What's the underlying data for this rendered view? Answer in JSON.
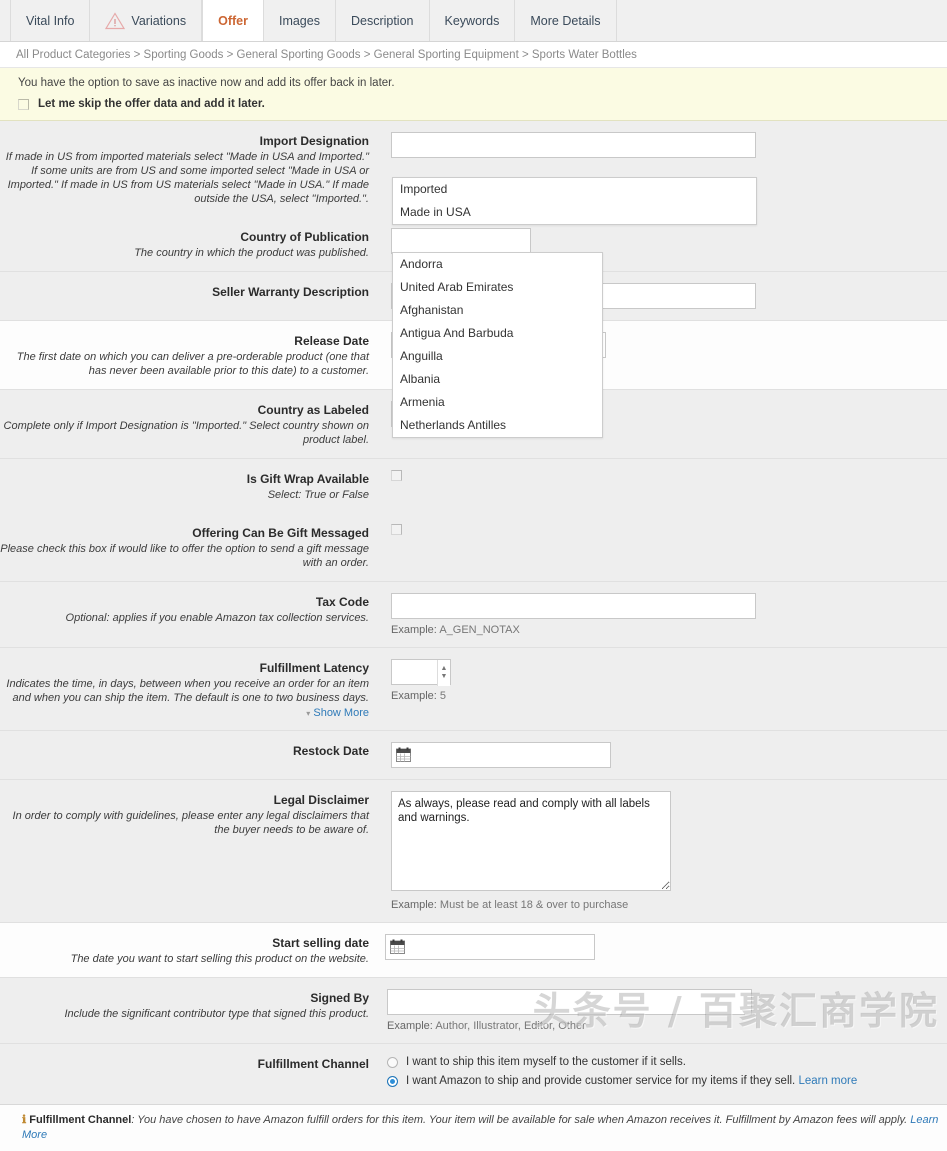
{
  "tabs": [
    {
      "label": "Vital Info",
      "icon": null,
      "active": false
    },
    {
      "label": "Variations",
      "icon": "warning-triangle-icon",
      "active": false
    },
    {
      "label": "Offer",
      "icon": null,
      "active": true
    },
    {
      "label": "Images",
      "icon": null,
      "active": false
    },
    {
      "label": "Description",
      "icon": null,
      "active": false
    },
    {
      "label": "Keywords",
      "icon": null,
      "active": false
    },
    {
      "label": "More Details",
      "icon": null,
      "active": false
    }
  ],
  "breadcrumb": "All Product Categories > Sporting Goods > General Sporting Goods > General Sporting Equipment > Sports Water Bottles",
  "notice": {
    "message": "You have the option to save as inactive now and add its offer back in later.",
    "checkbox_label": "Let me skip the offer data and add it later."
  },
  "fields": {
    "import_designation": {
      "label": "Import Designation",
      "description": "If made in US from imported materials select \"Made in USA and Imported.\" If some units are from US and some imported select \"Made in USA or Imported.\" If made in US from US materials select \"Made in USA.\" If made outside the USA, select \"Imported.\".",
      "value": "",
      "options": [
        "Imported",
        "Made in USA"
      ]
    },
    "country_of_publication": {
      "label": "Country of Publication",
      "description": "The country in which the product was published.",
      "value": "",
      "options": [
        "Andorra",
        "United Arab Emirates",
        "Afghanistan",
        "Antigua And Barbuda",
        "Anguilla",
        "Albania",
        "Armenia",
        "Netherlands Antilles"
      ]
    },
    "seller_warranty_description": {
      "label": "Seller Warranty Description",
      "description": "",
      "value": ""
    },
    "release_date": {
      "label": "Release Date",
      "description": "The first date on which you can deliver a pre-orderable product (one that has never been available prior to this date) to a customer.",
      "value": ""
    },
    "country_as_labeled": {
      "label": "Country as Labeled",
      "description": "Complete only if Import Designation is \"Imported.\" Select country shown on product label.",
      "value": ""
    },
    "is_gift_wrap_available": {
      "label": "Is Gift Wrap Available",
      "description": "Select: True or False",
      "checked": false
    },
    "offering_can_be_gift_messaged": {
      "label": "Offering Can Be Gift Messaged",
      "description": "Please check this box if would like to offer the option to send a gift message with an order.",
      "checked": false
    },
    "tax_code": {
      "label": "Tax Code",
      "description": "Optional: applies if you enable Amazon tax collection services.",
      "value": "",
      "example_label": "Example:",
      "example_value": "A_GEN_NOTAX"
    },
    "fulfillment_latency": {
      "label": "Fulfillment Latency",
      "description": "Indicates the time, in days, between when you receive an order for an item and when you can ship the item.  The default is one to two business days.",
      "show_more": "Show More",
      "value": "",
      "example_label": "Example:",
      "example_value": "5"
    },
    "restock_date": {
      "label": "Restock Date",
      "description": "",
      "value": ""
    },
    "legal_disclaimer": {
      "label": "Legal Disclaimer",
      "description": "In order to comply with guidelines, please enter any legal disclaimers that the buyer needs to be aware of.",
      "value": "As always, please read and comply with all labels and warnings.",
      "example_label": "Example:",
      "example_value": "Must be at least 18 & over to purchase"
    },
    "start_selling_date": {
      "label": "Start selling date",
      "description": "The date you want to start selling this product on the website.",
      "value": ""
    },
    "signed_by": {
      "label": "Signed By",
      "description": "Include the significant contributor type that signed this product.",
      "value": "",
      "example_label": "Example:",
      "example_value": "Author, Illustrator, Editor, Other"
    },
    "fulfillment_channel": {
      "label": "Fulfillment Channel",
      "option1": "I want to ship this item myself to the customer if it sells.",
      "option2": "I want Amazon to ship and provide customer service for my items if they sell.",
      "option2_link": "Learn more",
      "selected": "option2"
    }
  },
  "footer": {
    "title": "Fulfillment Channel",
    "separator": ":",
    "text": "You have chosen to have Amazon fulfill orders for this item. Your item will be available for sale when Amazon receives it. Fulfillment by Amazon fees will apply.",
    "link": "Learn More"
  },
  "watermark": "头条号 / 百聚汇商学院"
}
